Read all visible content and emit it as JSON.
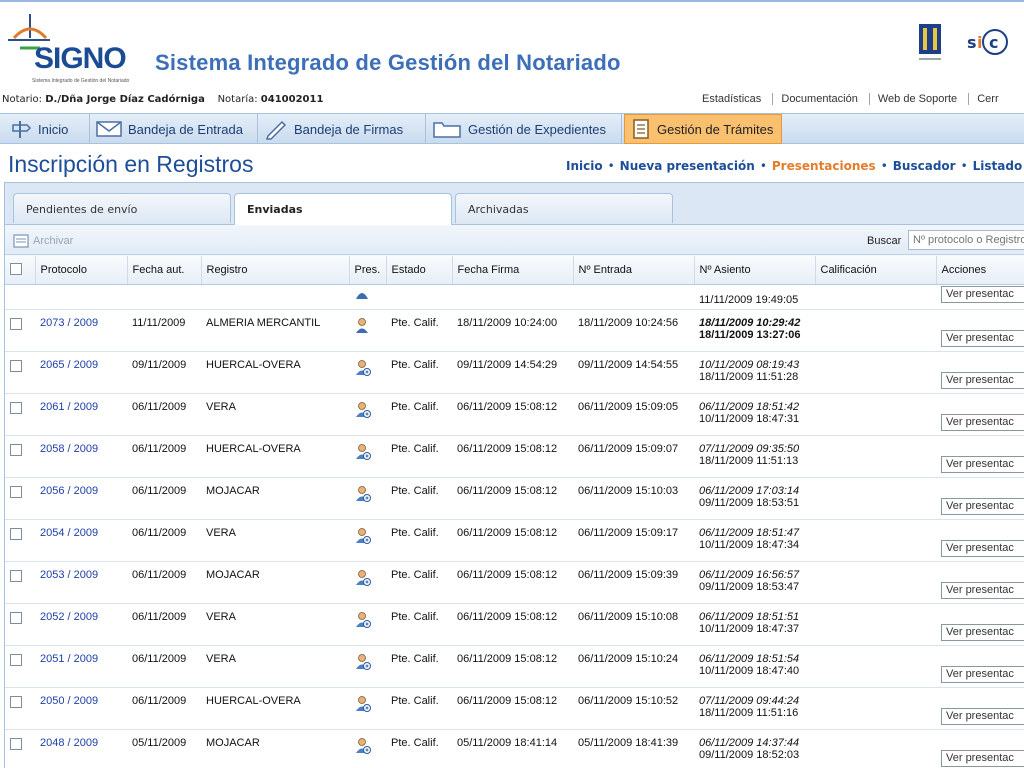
{
  "header": {
    "logo_text": "SIGNO",
    "logo_sub": "Sistema Integrado de Gestión del Notariado",
    "app_title": "Sistema Integrado de Gestión del Notariado",
    "right_logo_text": "sic"
  },
  "notaria": {
    "notario_label": "Notario:",
    "notario_name": "D./Dña Jorge Díaz Cadórniga",
    "notaria_label": "Notaría:",
    "notaria_code": "041002011"
  },
  "util_links": [
    "Estadísticas",
    "Documentación",
    "Web de Soporte",
    "Cerr"
  ],
  "nav": {
    "inicio": "Inicio",
    "bandeja_entrada": "Bandeja de Entrada",
    "bandeja_firmas": "Bandeja de Firmas",
    "gestion_expedientes": "Gestión de Expedientes",
    "gestion_tramites": "Gestión de Trámites"
  },
  "page": {
    "title": "Inscripción en Registros",
    "breadcrumb": [
      "Inicio",
      "Nueva presentación",
      "Presentaciones",
      "Buscador",
      "Listado de I"
    ],
    "breadcrumb_current_index": 2
  },
  "tabs": [
    "Pendientes de envío",
    "Enviadas",
    "Archivadas"
  ],
  "toolbar": {
    "archivar": "Archivar",
    "buscar_label": "Buscar",
    "search_placeholder": "Nº protocolo o Registro"
  },
  "table": {
    "headers": [
      "Protocolo",
      "Fecha aut.",
      "Registro",
      "Pres.",
      "Estado",
      "Fecha Firma",
      "Nº Entrada",
      "Nº Asiento",
      "Calificación",
      "Acciones"
    ],
    "partial_row": {
      "asiento2": "11/11/2009 19:49:05",
      "action": "Ver presentac"
    },
    "rows": [
      {
        "protocolo": "2073 / 2009",
        "fecha_aut": "11/11/2009",
        "registro": "ALMERIA MERCANTIL",
        "estado": "Pte. Calif.",
        "fecha_firma": "18/11/2009 10:24:00",
        "entrada": "18/11/2009 10:24:56",
        "asiento1": "18/11/2009 10:29:42",
        "asiento2": "18/11/2009 13:27:06",
        "action": "Ver presentac"
      },
      {
        "protocolo": "2065 / 2009",
        "fecha_aut": "09/11/2009",
        "registro": "HUERCAL-OVERA",
        "estado": "Pte. Calif.",
        "fecha_firma": "09/11/2009 14:54:29",
        "entrada": "09/11/2009 14:54:55",
        "asiento1": "10/11/2009 08:19:43",
        "asiento2": "18/11/2009 11:51:28",
        "action": "Ver presentac"
      },
      {
        "protocolo": "2061 / 2009",
        "fecha_aut": "06/11/2009",
        "registro": "VERA",
        "estado": "Pte. Calif.",
        "fecha_firma": "06/11/2009 15:08:12",
        "entrada": "06/11/2009 15:09:05",
        "asiento1": "06/11/2009 18:51:42",
        "asiento2": "10/11/2009 18:47:31",
        "action": "Ver presentac"
      },
      {
        "protocolo": "2058 / 2009",
        "fecha_aut": "06/11/2009",
        "registro": "HUERCAL-OVERA",
        "estado": "Pte. Calif.",
        "fecha_firma": "06/11/2009 15:08:12",
        "entrada": "06/11/2009 15:09:07",
        "asiento1": "07/11/2009 09:35:50",
        "asiento2": "18/11/2009 11:51:13",
        "action": "Ver presentac"
      },
      {
        "protocolo": "2056 / 2009",
        "fecha_aut": "06/11/2009",
        "registro": "MOJACAR",
        "estado": "Pte. Calif.",
        "fecha_firma": "06/11/2009 15:08:12",
        "entrada": "06/11/2009 15:10:03",
        "asiento1": "06/11/2009 17:03:14",
        "asiento2": "09/11/2009 18:53:51",
        "action": "Ver presentac"
      },
      {
        "protocolo": "2054 / 2009",
        "fecha_aut": "06/11/2009",
        "registro": "VERA",
        "estado": "Pte. Calif.",
        "fecha_firma": "06/11/2009 15:08:12",
        "entrada": "06/11/2009 15:09:17",
        "asiento1": "06/11/2009 18:51:47",
        "asiento2": "10/11/2009 18:47:34",
        "action": "Ver presentac"
      },
      {
        "protocolo": "2053 / 2009",
        "fecha_aut": "06/11/2009",
        "registro": "MOJACAR",
        "estado": "Pte. Calif.",
        "fecha_firma": "06/11/2009 15:08:12",
        "entrada": "06/11/2009 15:09:39",
        "asiento1": "06/11/2009 16:56:57",
        "asiento2": "09/11/2009 18:53:47",
        "action": "Ver presentac"
      },
      {
        "protocolo": "2052 / 2009",
        "fecha_aut": "06/11/2009",
        "registro": "VERA",
        "estado": "Pte. Calif.",
        "fecha_firma": "06/11/2009 15:08:12",
        "entrada": "06/11/2009 15:10:08",
        "asiento1": "06/11/2009 18:51:51",
        "asiento2": "10/11/2009 18:47:37",
        "action": "Ver presentac"
      },
      {
        "protocolo": "2051 / 2009",
        "fecha_aut": "06/11/2009",
        "registro": "VERA",
        "estado": "Pte. Calif.",
        "fecha_firma": "06/11/2009 15:08:12",
        "entrada": "06/11/2009 15:10:24",
        "asiento1": "06/11/2009 18:51:54",
        "asiento2": "10/11/2009 18:47:40",
        "action": "Ver presentac"
      },
      {
        "protocolo": "2050 / 2009",
        "fecha_aut": "06/11/2009",
        "registro": "HUERCAL-OVERA",
        "estado": "Pte. Calif.",
        "fecha_firma": "06/11/2009 15:08:12",
        "entrada": "06/11/2009 15:10:52",
        "asiento1": "07/11/2009 09:44:24",
        "asiento2": "18/11/2009 11:51:16",
        "action": "Ver presentac"
      },
      {
        "protocolo": "2048 / 2009",
        "fecha_aut": "05/11/2009",
        "registro": "MOJACAR",
        "estado": "Pte. Calif.",
        "fecha_firma": "05/11/2009 18:41:14",
        "entrada": "05/11/2009 18:41:39",
        "asiento1": "06/11/2009 14:37:44",
        "asiento2": "09/11/2009 18:52:03",
        "action": "Ver presentac"
      }
    ]
  }
}
